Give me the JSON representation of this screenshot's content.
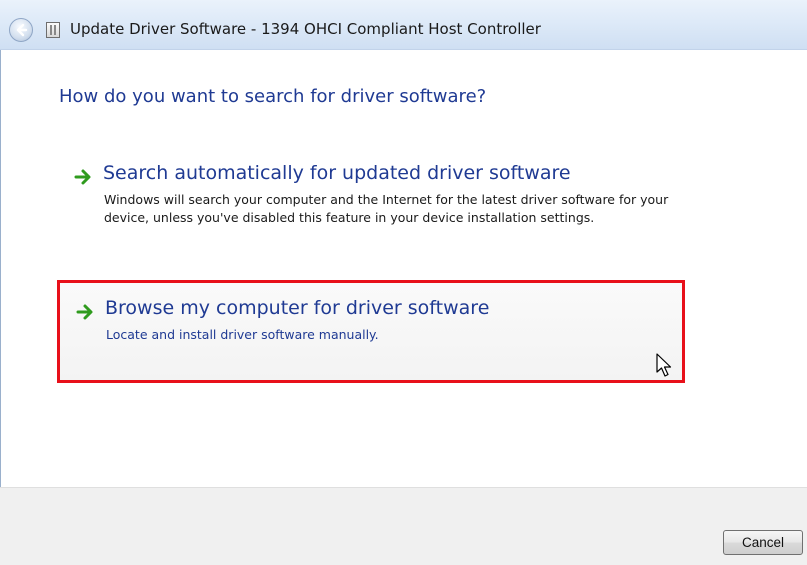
{
  "window": {
    "title": "Update Driver Software - 1394 OHCI Compliant Host Controller"
  },
  "main": {
    "heading": "How do you want to search for driver software?",
    "options": [
      {
        "title": "Search automatically for updated driver software",
        "description": "Windows will search your computer and the Internet for the latest driver software for your device, unless you've disabled this feature in your device installation settings.",
        "icon": "green-arrow-icon"
      },
      {
        "title": "Browse my computer for driver software",
        "description": "Locate and install driver software manually.",
        "icon": "green-arrow-icon",
        "highlighted": true
      }
    ]
  },
  "footer": {
    "cancel_label": "Cancel"
  },
  "colors": {
    "link_blue": "#1f3a93",
    "highlight_red": "#e8101a",
    "arrow_green": "#2f9b1e"
  }
}
